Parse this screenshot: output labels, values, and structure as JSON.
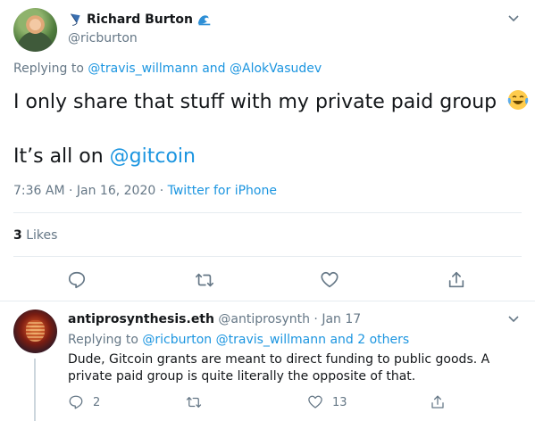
{
  "tweet": {
    "author_name": "Richard Burton",
    "author_handle": "@ricburton",
    "name_emoji_left": "kite-emoji",
    "name_emoji_right": "wave-emoji",
    "replying_prefix": "Replying to",
    "replying_users": [
      "@travis_willmann",
      "and",
      "@AlokVasudev"
    ],
    "text_line1": "I only share that stuff with my private paid group",
    "text_emoji": "tears-of-joy-emoji",
    "text_line2_prefix": "It’s all on",
    "text_line2_mention": "@gitcoin",
    "timestamp": "7:36 AM · Jan 16, 2020 ·",
    "source": "Twitter for iPhone",
    "likes_count": "3",
    "likes_label": "Likes"
  },
  "reply": {
    "author_name": "antiprosynthesis.eth",
    "author_handle": "@antiprosynth",
    "date": "· Jan 17",
    "replying_prefix": "Replying to",
    "replying_users": "@ricburton @travis_willmann and 2 others",
    "text": "Dude, Gitcoin grants are meant to direct funding to public goods. A private paid group is quite literally the opposite of that.",
    "reply_count": "2",
    "retweet_count": "",
    "like_count": "13"
  },
  "colors": {
    "link": "#1b95e0",
    "secondary_text": "#657786",
    "primary_text": "#14171a",
    "divider": "#e6ecf0"
  }
}
